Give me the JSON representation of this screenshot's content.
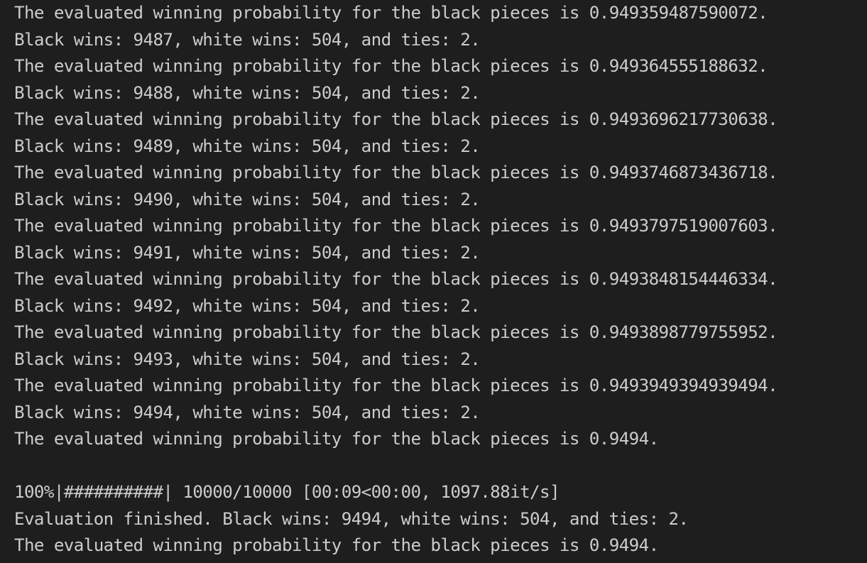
{
  "terminal": {
    "lines": [
      "The evaluated winning probability for the black pieces is 0.949359487590072.",
      "Black wins: 9487, white wins: 504, and ties: 2.",
      "The evaluated winning probability for the black pieces is 0.949364555188632.",
      "Black wins: 9488, white wins: 504, and ties: 2.",
      "The evaluated winning probability for the black pieces is 0.9493696217730638.",
      "Black wins: 9489, white wins: 504, and ties: 2.",
      "The evaluated winning probability for the black pieces is 0.9493746873436718.",
      "Black wins: 9490, white wins: 504, and ties: 2.",
      "The evaluated winning probability for the black pieces is 0.9493797519007603.",
      "Black wins: 9491, white wins: 504, and ties: 2.",
      "The evaluated winning probability for the black pieces is 0.9493848154446334.",
      "Black wins: 9492, white wins: 504, and ties: 2.",
      "The evaluated winning probability for the black pieces is 0.9493898779755952.",
      "Black wins: 9493, white wins: 504, and ties: 2.",
      "The evaluated winning probability for the black pieces is 0.9493949394939494.",
      "Black wins: 9494, white wins: 504, and ties: 2.",
      "The evaluated winning probability for the black pieces is 0.9494.",
      "",
      "100%|##########| 10000/10000 [00:09<00:00, 1097.88it/s]",
      "Evaluation finished. Black wins: 9494, white wins: 504, and ties: 2.",
      "The evaluated winning probability for the black pieces is 0.9494."
    ],
    "colors": {
      "background": "#1e1e1e",
      "text": "#cccccc"
    }
  }
}
